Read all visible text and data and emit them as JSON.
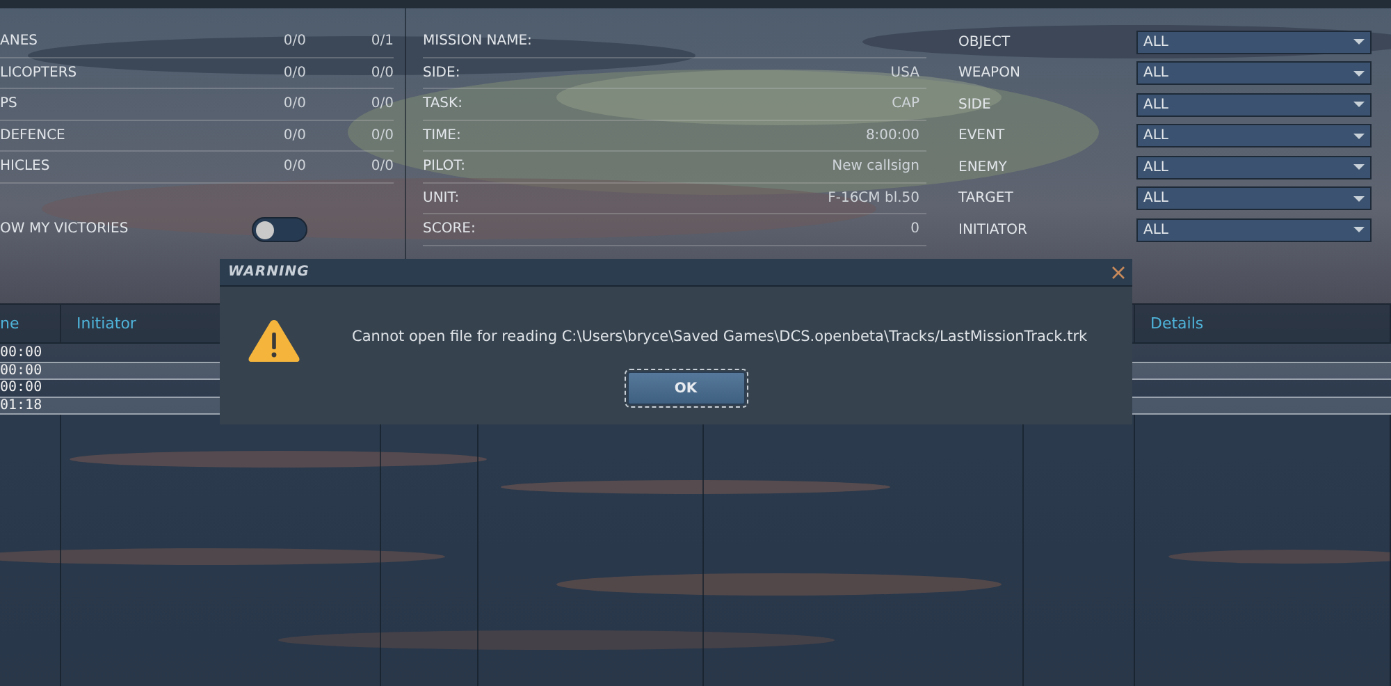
{
  "stats": [
    {
      "label": "ANES",
      "col_1": "0/0",
      "col_2": "0/1"
    },
    {
      "label": "LICOPTERS",
      "col_1": "0/0",
      "col_2": "0/0"
    },
    {
      "label": "PS",
      "col_1": "0/0",
      "col_2": "0/0"
    },
    {
      "label": "DEFENCE",
      "col_1": "0/0",
      "col_2": "0/0"
    },
    {
      "label": "HICLES",
      "col_1": "0/0",
      "col_2": "0/0"
    }
  ],
  "victories_toggle": {
    "label": "OW MY VICTORIES",
    "on": false
  },
  "mission": [
    {
      "label": "MISSION NAME:"
    },
    {
      "label": "SIDE:",
      "value": "USA"
    },
    {
      "label": "TASK:",
      "value": "CAP"
    },
    {
      "label": "TIME:",
      "value": "8:00:00"
    },
    {
      "label": "PILOT:",
      "value": "New callsign"
    },
    {
      "label": "UNIT:",
      "value": "F-16CM bl.50"
    },
    {
      "label": "SCORE:",
      "value": "0"
    }
  ],
  "filters": [
    {
      "label": "OBJECT",
      "value": "ALL"
    },
    {
      "label": "WEAPON",
      "value": "ALL"
    },
    {
      "label": "SIDE",
      "value": "ALL"
    },
    {
      "label": "EVENT",
      "value": "ALL"
    },
    {
      "label": "ENEMY",
      "value": "ALL"
    },
    {
      "label": "TARGET",
      "value": "ALL"
    },
    {
      "label": "INITIATOR",
      "value": "ALL"
    }
  ],
  "table": {
    "columns": [
      {
        "label": "ne"
      },
      {
        "label": "Initiator"
      },
      {
        "label": "Details"
      }
    ],
    "rows": [
      {
        "time": "00:00"
      },
      {
        "time": "00:00"
      },
      {
        "time": "00:00"
      },
      {
        "time": "01:18"
      }
    ]
  },
  "dialog": {
    "title": "WARNING",
    "message": "Cannot open file for reading C:\\Users\\bryce\\Saved Games\\DCS.openbeta\\Tracks/LastMissionTrack.trk",
    "button": "OK"
  }
}
